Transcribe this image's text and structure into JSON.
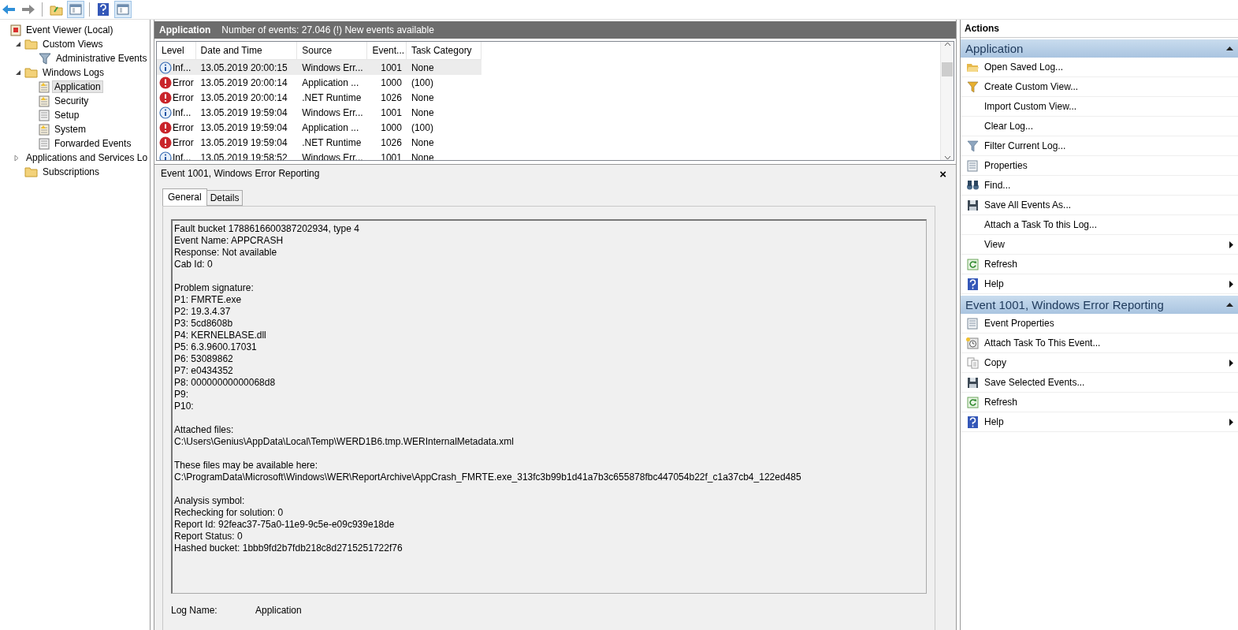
{
  "toolbar": [
    {
      "kind": "back",
      "on": false
    },
    {
      "kind": "forward",
      "on": false
    },
    {
      "kind": "folder",
      "on": false
    },
    {
      "kind": "pane",
      "on": true
    },
    {
      "kind": "help",
      "on": false
    },
    {
      "kind": "pane",
      "on": true
    }
  ],
  "tree": [
    {
      "label": "Event Viewer (Local)",
      "kind": "viewer",
      "selected": false,
      "children": [
        {
          "label": "Custom Views",
          "kind": "folder",
          "expanded": true,
          "selected": false,
          "children": [
            {
              "label": "Administrative Events",
              "kind": "filter",
              "selected": false
            }
          ]
        },
        {
          "label": "Windows Logs",
          "kind": "folder",
          "expanded": true,
          "selected": false,
          "children": [
            {
              "label": "Application",
              "kind": "log",
              "selected": true
            },
            {
              "label": "Security",
              "kind": "log",
              "selected": false
            },
            {
              "label": "Setup",
              "kind": "plainlog",
              "selected": false
            },
            {
              "label": "System",
              "kind": "log",
              "selected": false
            },
            {
              "label": "Forwarded Events",
              "kind": "plainlog",
              "selected": false
            }
          ]
        },
        {
          "label": "Applications and Services Lo",
          "kind": "folder",
          "expanded": false,
          "selected": false
        },
        {
          "label": "Subscriptions",
          "kind": "folder",
          "selected": false
        }
      ]
    }
  ],
  "log_header": {
    "title": "Application",
    "info": "Number of events: 27.046 (!) New events available"
  },
  "events": {
    "columns": [
      "Level",
      "Date and Time",
      "Source",
      "Event...",
      "Task Category"
    ],
    "rows": [
      {
        "kind": "info",
        "level_text": "Inf...",
        "date": "13.05.2019 20:00:15",
        "source": "Windows Err...",
        "event_id": "1001",
        "category": "None",
        "selected": true
      },
      {
        "kind": "error",
        "level_text": "Error",
        "date": "13.05.2019 20:00:14",
        "source": "Application ...",
        "event_id": "1000",
        "category": "(100)",
        "selected": false
      },
      {
        "kind": "error",
        "level_text": "Error",
        "date": "13.05.2019 20:00:14",
        "source": ".NET Runtime",
        "event_id": "1026",
        "category": "None",
        "selected": false
      },
      {
        "kind": "info",
        "level_text": "Inf...",
        "date": "13.05.2019 19:59:04",
        "source": "Windows Err...",
        "event_id": "1001",
        "category": "None",
        "selected": false
      },
      {
        "kind": "error",
        "level_text": "Error",
        "date": "13.05.2019 19:59:04",
        "source": "Application ...",
        "event_id": "1000",
        "category": "(100)",
        "selected": false
      },
      {
        "kind": "error",
        "level_text": "Error",
        "date": "13.05.2019 19:59:04",
        "source": ".NET Runtime",
        "event_id": "1026",
        "category": "None",
        "selected": false
      },
      {
        "kind": "info",
        "level_text": "Inf...",
        "date": "13.05.2019 19:58:52",
        "source": "Windows Err...",
        "event_id": "1001",
        "category": "None",
        "selected": false
      }
    ]
  },
  "detail": {
    "title": "Event 1001, Windows Error Reporting",
    "close": "×",
    "tabs": [
      {
        "label": "General",
        "selected": true
      },
      {
        "label": "Details",
        "selected": false
      }
    ],
    "paragraphs": [
      [
        "Fault bucket 1788616600387202934, type 4",
        "Event Name: APPCRASH",
        "Response: Not available",
        "Cab Id: 0"
      ],
      [
        "Problem signature:",
        "P1: FMRTE.exe",
        "P2: 19.3.4.37",
        "P3: 5cd8608b",
        "P4: KERNELBASE.dll",
        "P5: 6.3.9600.17031",
        "P6: 53089862",
        "P7: e0434352",
        "P8: 00000000000068d8",
        "P9:",
        "P10:"
      ],
      [
        "Attached files:",
        "C:\\Users\\Genius\\AppData\\Local\\Temp\\WERD1B6.tmp.WERInternalMetadata.xml"
      ],
      [
        "These files may be available here:",
        "C:\\ProgramData\\Microsoft\\Windows\\WER\\ReportArchive\\AppCrash_FMRTE.exe_313fc3b99b1d41a7b3c655878fbc447054b22f_c1a37cb4_122ed485"
      ],
      [
        "Analysis symbol:",
        "Rechecking for solution: 0",
        "Report Id: 92feac37-75a0-11e9-9c5e-e09c939e18de",
        "Report Status: 0",
        "Hashed bucket: 1bbb9fd2b7fdb218c8d2715251722f76"
      ]
    ],
    "fields": [
      {
        "label": "Log Name:",
        "value": "Application"
      }
    ]
  },
  "actions": {
    "title": "Actions",
    "sections": [
      {
        "title": "Application",
        "expanded": true,
        "items": [
          {
            "label": "Open Saved Log...",
            "kind": "folder",
            "submenu": false
          },
          {
            "label": "Create Custom View...",
            "kind": "filter",
            "submenu": false
          },
          {
            "label": "Import Custom View...",
            "kind": "none",
            "submenu": false
          },
          {
            "label": "Clear Log...",
            "kind": "none",
            "submenu": false
          },
          {
            "label": "Filter Current Log...",
            "kind": "filter2",
            "submenu": false
          },
          {
            "label": "Properties",
            "kind": "props",
            "submenu": false
          },
          {
            "label": "Find...",
            "kind": "find",
            "submenu": false
          },
          {
            "label": "Save All Events As...",
            "kind": "save",
            "submenu": false
          },
          {
            "label": "Attach a Task To this Log...",
            "kind": "none",
            "submenu": false
          },
          {
            "label": "View",
            "kind": "none",
            "submenu": true
          },
          {
            "label": "Refresh",
            "kind": "refresh",
            "submenu": false
          },
          {
            "label": "Help",
            "kind": "help",
            "submenu": true
          }
        ]
      },
      {
        "title": "Event 1001, Windows Error Reporting",
        "expanded": true,
        "items": [
          {
            "label": "Event Properties",
            "kind": "props",
            "submenu": false
          },
          {
            "label": "Attach Task To This Event...",
            "kind": "task",
            "submenu": false
          },
          {
            "label": "Copy",
            "kind": "copy",
            "submenu": true
          },
          {
            "label": "Save Selected Events...",
            "kind": "save",
            "submenu": false
          },
          {
            "label": "Refresh",
            "kind": "refresh",
            "submenu": false
          },
          {
            "label": "Help",
            "kind": "help",
            "submenu": true
          }
        ]
      }
    ]
  }
}
